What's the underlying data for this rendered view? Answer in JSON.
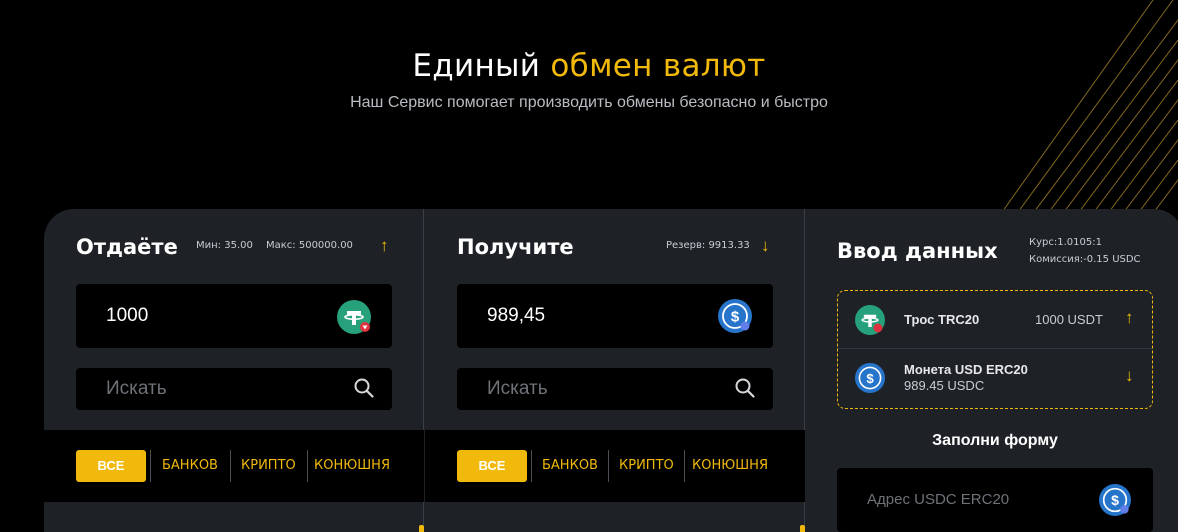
{
  "hero": {
    "title_part1": "Единый ",
    "title_accent": "обмен валют",
    "subtitle": "Наш Сервис помогает производить обмены безопасно и быстро"
  },
  "give": {
    "title": "Отдаёте",
    "min": "Мин: 35.00",
    "max": "Макс: 500000.00",
    "amount": "1000",
    "coin_icon": "tether-icon",
    "search_placeholder": "Искать"
  },
  "receive": {
    "title": "Получите",
    "reserve": "Резерв: 9913.33",
    "amount": "989,45",
    "coin_icon": "usdc-icon",
    "search_placeholder": "Искать"
  },
  "filters": {
    "all": "ВСЕ",
    "banks": "БАНКОВ",
    "crypto": "КРИПТО",
    "stable": "КОНЮШНЯ"
  },
  "info": {
    "title": "Ввод данных",
    "rate": "Курс:1.0105:1",
    "fee": "Комиссия:-0.15 USDC",
    "from_name": "Трос TRC20",
    "from_amount": "1000 USDT",
    "to_name": "Монета USD ERC20",
    "to_amount": "989.45 USDC",
    "form_title": "Заполни форму",
    "address_placeholder": "Адрес USDC ERC20"
  },
  "colors": {
    "accent": "#f0b90b",
    "panel": "#1e2227",
    "tether": "#26a17b",
    "usdc": "#2775ca"
  }
}
